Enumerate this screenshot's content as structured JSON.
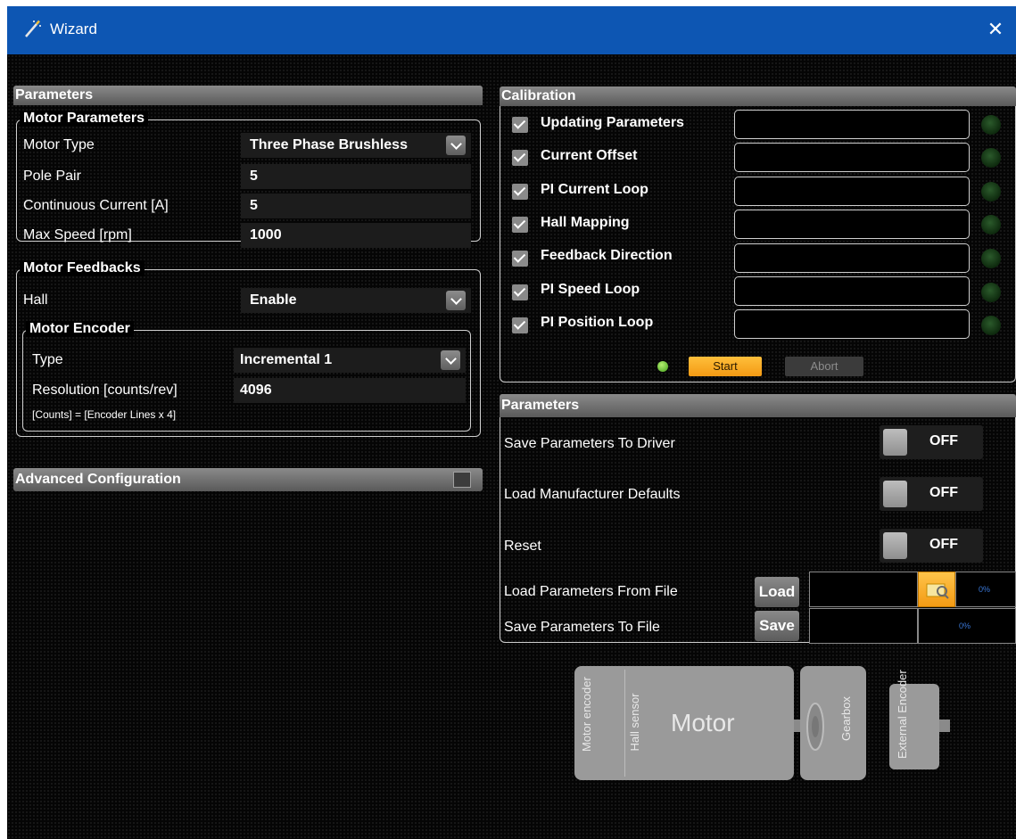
{
  "window": {
    "title": "Wizard",
    "close_symbol": "✕"
  },
  "left": {
    "parameters_header": "Parameters",
    "motor_parameters": {
      "legend": "Motor Parameters",
      "rows": [
        {
          "label": "Motor Type",
          "value": "Three Phase Brushless"
        },
        {
          "label": "Pole Pair",
          "value": "5"
        },
        {
          "label": "Continuous Current [A]",
          "value": "5"
        },
        {
          "label": "Max Speed [rpm]",
          "value": "1000"
        }
      ]
    },
    "motor_feedbacks": {
      "legend": "Motor Feedbacks",
      "hall_label": "Hall",
      "hall_value": "Enable",
      "encoder": {
        "legend": "Motor Encoder",
        "type_label": "Type",
        "type_value": "Incremental 1",
        "resolution_label": "Resolution [counts/rev]",
        "resolution_value": "4096",
        "note": "[Counts] = [Encoder Lines  x  4]"
      }
    },
    "advanced_header": "Advanced Configuration"
  },
  "calibration": {
    "header": "Calibration",
    "items": [
      {
        "label": "Updating Parameters",
        "checked": true
      },
      {
        "label": "Current Offset",
        "checked": true
      },
      {
        "label": "PI Current Loop",
        "checked": true
      },
      {
        "label": "Hall Mapping",
        "checked": true
      },
      {
        "label": "Feedback Direction",
        "checked": true
      },
      {
        "label": "PI Speed Loop",
        "checked": true
      },
      {
        "label": "PI Position Loop",
        "checked": true
      }
    ],
    "start_label": "Start",
    "abort_label": "Abort"
  },
  "right_parameters": {
    "header": "Parameters",
    "toggles": [
      {
        "label": "Save Parameters To Driver",
        "state": "OFF"
      },
      {
        "label": "Load Manufacturer Defaults",
        "state": "OFF"
      },
      {
        "label": "Reset",
        "state": "OFF"
      }
    ],
    "load_file": {
      "label": "Load Parameters From File",
      "button": "Load",
      "progress": "0%"
    },
    "save_file": {
      "label": "Save Parameters To File",
      "button": "Save",
      "progress": "0%"
    }
  },
  "diagram": {
    "motor_encoder": "Motor encoder",
    "hall_sensor": "Hall sensor",
    "motor": "Motor",
    "gearbox": "Gearbox",
    "external_encoder": "External Encoder"
  },
  "colors": {
    "titlebar": "#0d56b3",
    "accent_orange": "#f39a14",
    "led_green": "#43a11c"
  }
}
